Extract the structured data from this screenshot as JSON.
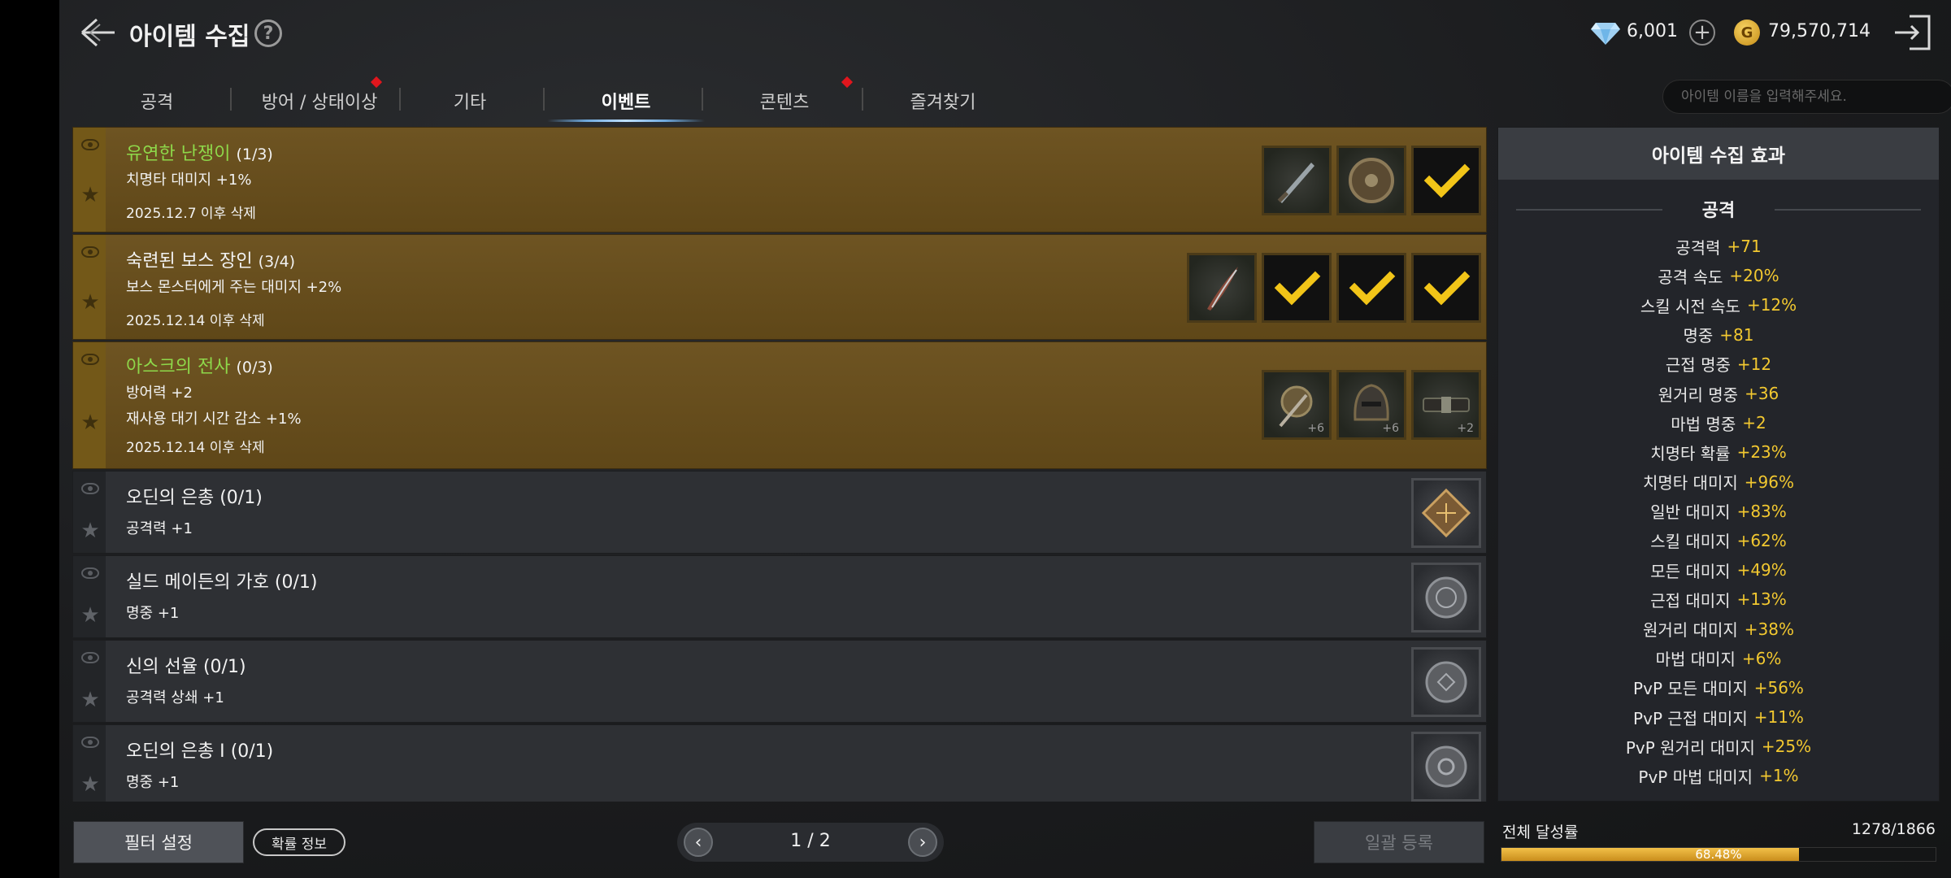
{
  "header": {
    "title": "아이템 수집",
    "help": "?",
    "diamond": "6,001",
    "gold_symbol": "G",
    "gold": "79,570,714"
  },
  "tabs": [
    {
      "label": "공격"
    },
    {
      "label": "방어 / 상태이상"
    },
    {
      "label": "기타"
    },
    {
      "label": "이벤트"
    },
    {
      "label": "콘텐츠"
    },
    {
      "label": "즐겨찾기"
    }
  ],
  "search": {
    "placeholder": "아이템 이름을 입력해주세요."
  },
  "items": [
    {
      "title": "유연한 난쟁이",
      "progress": "(1/3)",
      "effects": [
        "치명타 대미지 +1%"
      ],
      "date": "2025.12.7 이후 삭제"
    },
    {
      "title": "숙련된 보스 장인",
      "progress": "(3/4)",
      "effects": [
        "보스 몬스터에게 주는 대미지 +2%"
      ],
      "date": "2025.12.14 이후 삭제"
    },
    {
      "title": "아스크의 전사",
      "progress": "(0/3)",
      "effects": [
        "방어력 +2",
        "재사용 대기 시간 감소 +1%"
      ],
      "date": "2025.12.14 이후 삭제",
      "levels": [
        "+6",
        "+6",
        "+2"
      ]
    },
    {
      "title": "오딘의 은총",
      "progress": "(0/1)",
      "effects": [
        "공격력 +1"
      ]
    },
    {
      "title": "실드 메이든의 가호",
      "progress": "(0/1)",
      "effects": [
        "명중 +1"
      ]
    },
    {
      "title": "신의 선율",
      "progress": "(0/1)",
      "effects": [
        "공격력 상쇄 +1"
      ]
    },
    {
      "title": "오딘의 은총 I",
      "progress": "(0/1)",
      "effects": [
        "명중 +1"
      ]
    }
  ],
  "effects_panel": {
    "title": "아이템 수집 효과",
    "section": "공격",
    "stats": [
      {
        "name": "공격력",
        "value": "+71"
      },
      {
        "name": "공격 속도",
        "value": "+20%"
      },
      {
        "name": "스킬 시전 속도",
        "value": "+12%"
      },
      {
        "name": "명중",
        "value": "+81"
      },
      {
        "name": "근접 명중",
        "value": "+12"
      },
      {
        "name": "원거리 명중",
        "value": "+36"
      },
      {
        "name": "마법 명중",
        "value": "+2"
      },
      {
        "name": "치명타 확률",
        "value": "+23%"
      },
      {
        "name": "치명타 대미지",
        "value": "+96%"
      },
      {
        "name": "일반 대미지",
        "value": "+83%"
      },
      {
        "name": "스킬 대미지",
        "value": "+62%"
      },
      {
        "name": "모든 대미지",
        "value": "+49%"
      },
      {
        "name": "근접 대미지",
        "value": "+13%"
      },
      {
        "name": "원거리 대미지",
        "value": "+38%"
      },
      {
        "name": "마법 대미지",
        "value": "+6%"
      },
      {
        "name": "PvP 모든 대미지",
        "value": "+56%"
      },
      {
        "name": "PvP 근접 대미지",
        "value": "+11%"
      },
      {
        "name": "PvP 원거리 대미지",
        "value": "+25%"
      },
      {
        "name": "PvP 마법 대미지",
        "value": "+1%"
      }
    ]
  },
  "footer": {
    "filter": "필터 설정",
    "prob_info": "확률 정보",
    "page": "1 / 2",
    "bulk_register": "일괄 등록",
    "progress_label": "전체 달성률",
    "progress_count": "1278/1866",
    "progress_pct": "68.48%",
    "progress_fraction": 0.6848
  },
  "colors": {
    "accent_gold": "#f2c830",
    "highlight_green": "#8ed84a",
    "row_gold": "#6e5422",
    "row_gray": "#2e3034"
  }
}
